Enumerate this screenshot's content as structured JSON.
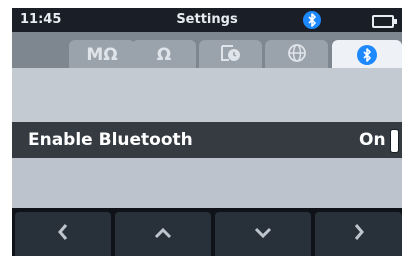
{
  "status_bar": {
    "time": "11:45",
    "title": "Settings",
    "bluetooth_icon": "bluetooth-icon",
    "battery_icon": "battery-icon"
  },
  "tabs": [
    {
      "label": "MΩ",
      "icon": "megohm-icon",
      "active": false
    },
    {
      "label": "Ω",
      "icon": "ohm-icon",
      "active": false
    },
    {
      "label": "",
      "icon": "clock-timer-icon",
      "active": false
    },
    {
      "label": "",
      "icon": "globe-icon",
      "active": false
    },
    {
      "label": "",
      "icon": "bluetooth-icon",
      "active": true
    }
  ],
  "setting": {
    "label": "Enable Bluetooth",
    "value": "On"
  },
  "nav": [
    {
      "icon": "chevron-left-icon"
    },
    {
      "icon": "chevron-up-icon"
    },
    {
      "icon": "chevron-down-icon"
    },
    {
      "icon": "chevron-right-icon"
    }
  ],
  "colors": {
    "accent": "#1e88ff",
    "status_bar": "#1a1f27",
    "row_selected": "#363b42"
  }
}
